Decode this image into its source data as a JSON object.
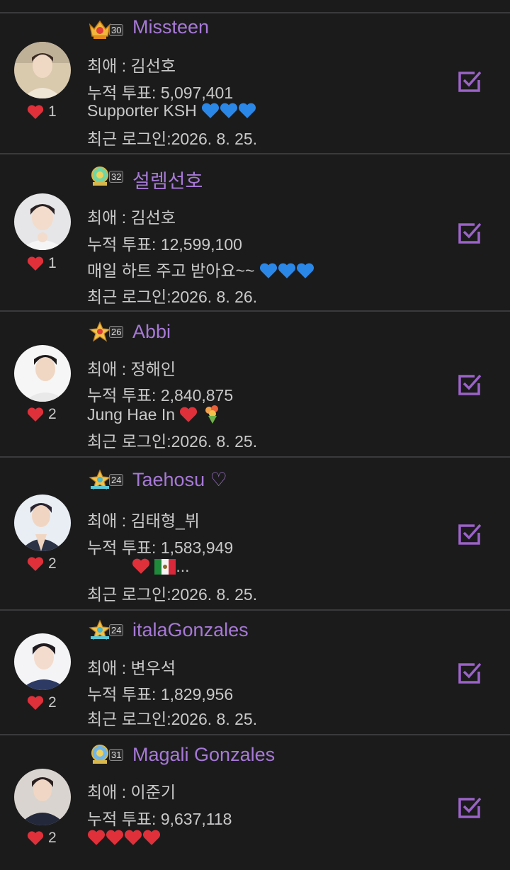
{
  "labels": {
    "favorite_prefix": "최애 : ",
    "votes_prefix": "누적 투표: ",
    "login_prefix": "최근 로그인:"
  },
  "colors": {
    "background": "#1b1b1c",
    "divider": "#3a3a3c",
    "nickname": "#a779d6",
    "check": "#9b63c8",
    "heart_red": "#e0303a",
    "heart_blue": "#2a87e8"
  },
  "users": [
    {
      "level": "30",
      "badge_icon": "crown-badge-red",
      "nickname": "Missteen",
      "favorite": "김선호",
      "votes": "5,097,401",
      "bio": " Supporter KSH",
      "bio_emoji": [
        "blue-heart",
        "blue-heart",
        "blue-heart"
      ],
      "last_login": "2026. 8. 25.",
      "likes": "1"
    },
    {
      "level": "32",
      "badge_icon": "crown-badge-green",
      "nickname": "설렘선호",
      "favorite": "김선호",
      "votes": "12,599,100",
      "bio": "매일 하트 주고 받아요~~",
      "bio_emoji": [
        "blue-heart",
        "blue-heart",
        "blue-heart"
      ],
      "last_login": "2026. 8. 26.",
      "likes": "1"
    },
    {
      "level": "26",
      "badge_icon": "star-badge-red",
      "nickname": "Abbi",
      "favorite": "정해인",
      "votes": "2,840,875",
      "bio": "Jung Hae In ",
      "bio_emoji": [
        "red-heart",
        "bouquet"
      ],
      "last_login": "2026. 8. 25.",
      "likes": "2"
    },
    {
      "level": "24",
      "badge_icon": "star-badge-teal",
      "nickname": "Taehosu ♡",
      "favorite": "김태형_뷔",
      "votes": "1,583,949",
      "bio": "...",
      "bio_emoji": [
        "red-heart",
        "mexico-flag"
      ],
      "last_login": "2026. 8. 25.",
      "likes": "2"
    },
    {
      "level": "24",
      "badge_icon": "star-badge-teal",
      "nickname": "italaGonzales",
      "favorite": "변우석",
      "votes": "1,829,956",
      "bio": "",
      "bio_emoji": [],
      "last_login": "2026. 8. 25.",
      "likes": "2"
    },
    {
      "level": "31",
      "badge_icon": "crown-badge-blue",
      "nickname": "Magali Gonzales",
      "favorite": "이준기",
      "votes": "9,637,118",
      "bio": "",
      "bio_emoji": [
        "red-heart",
        "red-heart",
        "red-heart",
        "red-heart"
      ],
      "last_login": "",
      "likes": "2"
    }
  ]
}
